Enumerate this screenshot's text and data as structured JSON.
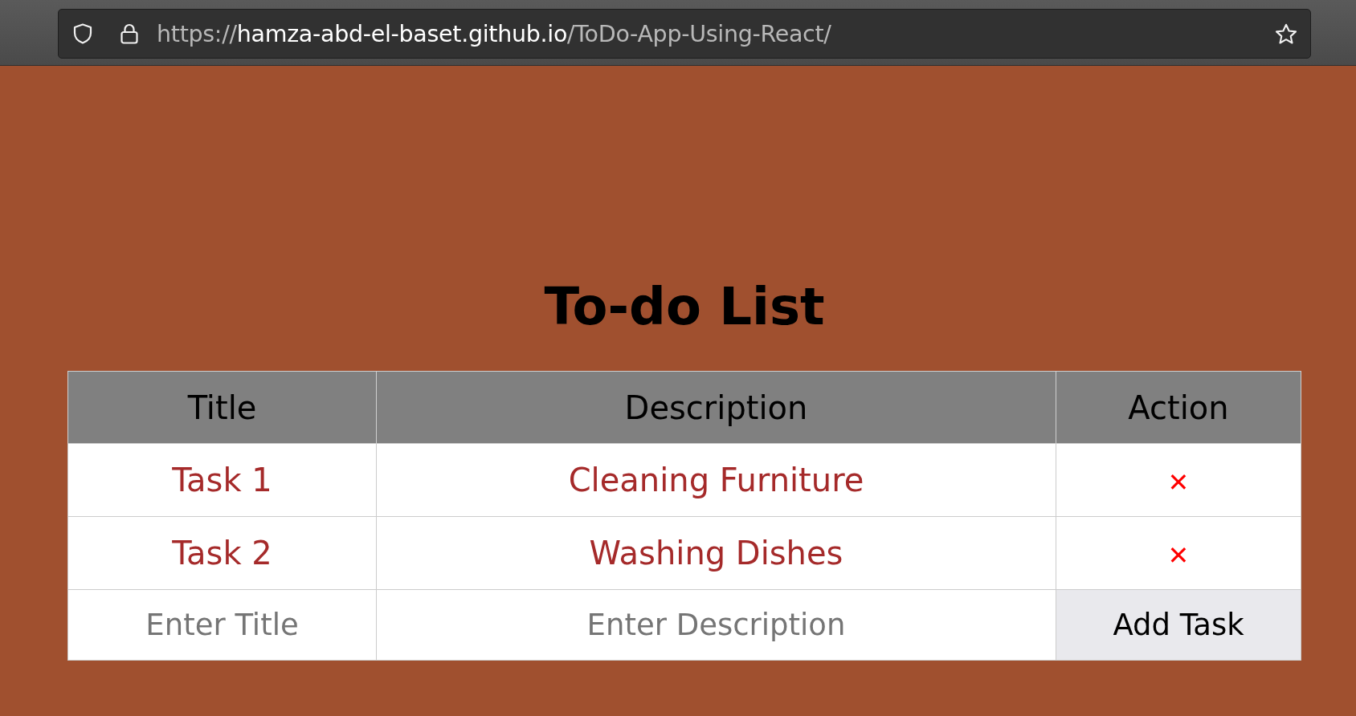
{
  "browser": {
    "url": {
      "scheme": "https://",
      "host": "hamza-abd-el-baset.github.io",
      "path": "/ToDo-App-Using-React/"
    }
  },
  "page": {
    "heading": "To-do List"
  },
  "table": {
    "columns": [
      "Title",
      "Description",
      "Action"
    ],
    "rows": [
      {
        "title": "Task 1",
        "description": "Cleaning Furniture",
        "action": "✕"
      },
      {
        "title": "Task 2",
        "description": "Washing Dishes",
        "action": "✕"
      }
    ],
    "entry_row": {
      "title": {
        "placeholder": "Enter Title"
      },
      "description": {
        "placeholder": "Enter Description"
      },
      "button": "Add Task"
    }
  }
}
